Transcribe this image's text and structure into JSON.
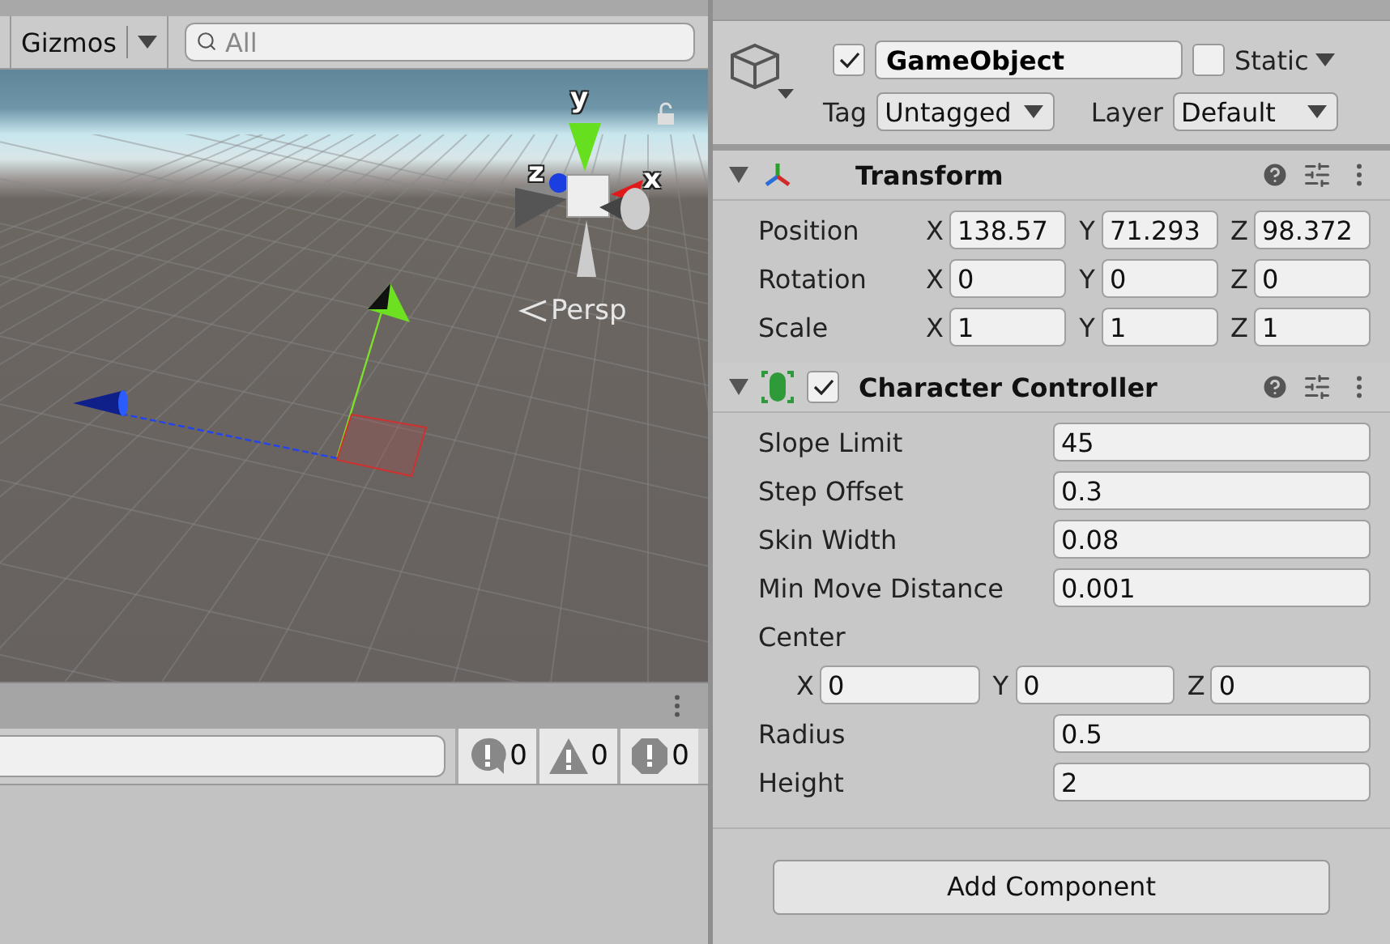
{
  "scene_toolbar": {
    "gizmos_label": "Gizmos",
    "search_placeholder": "All"
  },
  "scene": {
    "axis_labels": [
      "z",
      "y",
      "x"
    ],
    "projection": "Persp"
  },
  "console": {
    "counts": [
      {
        "kind": "info",
        "count": "0"
      },
      {
        "kind": "warning",
        "count": "0"
      },
      {
        "kind": "error",
        "count": "0"
      }
    ]
  },
  "inspector": {
    "object": {
      "active": true,
      "name": "GameObject",
      "static": false,
      "static_label": "Static",
      "tag_label": "Tag",
      "tag": "Untagged",
      "layer_label": "Layer",
      "layer": "Default"
    },
    "components": [
      {
        "kind": "transform",
        "title": "Transform",
        "expanded": true,
        "rows": [
          {
            "kind": "vector",
            "label": "Position",
            "values": [
              {
                "axis": "X",
                "value": "138.57"
              },
              {
                "axis": "Y",
                "value": "71.293"
              },
              {
                "axis": "Z",
                "value": "98.372"
              }
            ]
          },
          {
            "kind": "vector",
            "label": "Rotation",
            "values": [
              {
                "axis": "X",
                "value": "0"
              },
              {
                "axis": "Y",
                "value": "0"
              },
              {
                "axis": "Z",
                "value": "0"
              }
            ]
          },
          {
            "kind": "vector",
            "label": "Scale",
            "values": [
              {
                "axis": "X",
                "value": "1"
              },
              {
                "axis": "Y",
                "value": "1"
              },
              {
                "axis": "Z",
                "value": "1"
              }
            ]
          }
        ]
      },
      {
        "kind": "character_controller",
        "title": "Character Controller",
        "expanded": true,
        "enabled": true,
        "rows": [
          {
            "kind": "scalar",
            "label": "Slope Limit",
            "value": "45"
          },
          {
            "kind": "scalar",
            "label": "Step Offset",
            "value": "0.3"
          },
          {
            "kind": "scalar",
            "label": "Skin Width",
            "value": "0.08"
          },
          {
            "kind": "scalar",
            "label": "Min Move Distance",
            "value": "0.001"
          },
          {
            "kind": "heading",
            "label": "Center"
          },
          {
            "kind": "subvector",
            "values": [
              {
                "axis": "X",
                "value": "0"
              },
              {
                "axis": "Y",
                "value": "0"
              },
              {
                "axis": "Z",
                "value": "0"
              }
            ]
          },
          {
            "kind": "scalar",
            "label": "Radius",
            "value": "0.5"
          },
          {
            "kind": "scalar",
            "label": "Height",
            "value": "2"
          }
        ]
      }
    ],
    "add_button": "Add Component"
  }
}
